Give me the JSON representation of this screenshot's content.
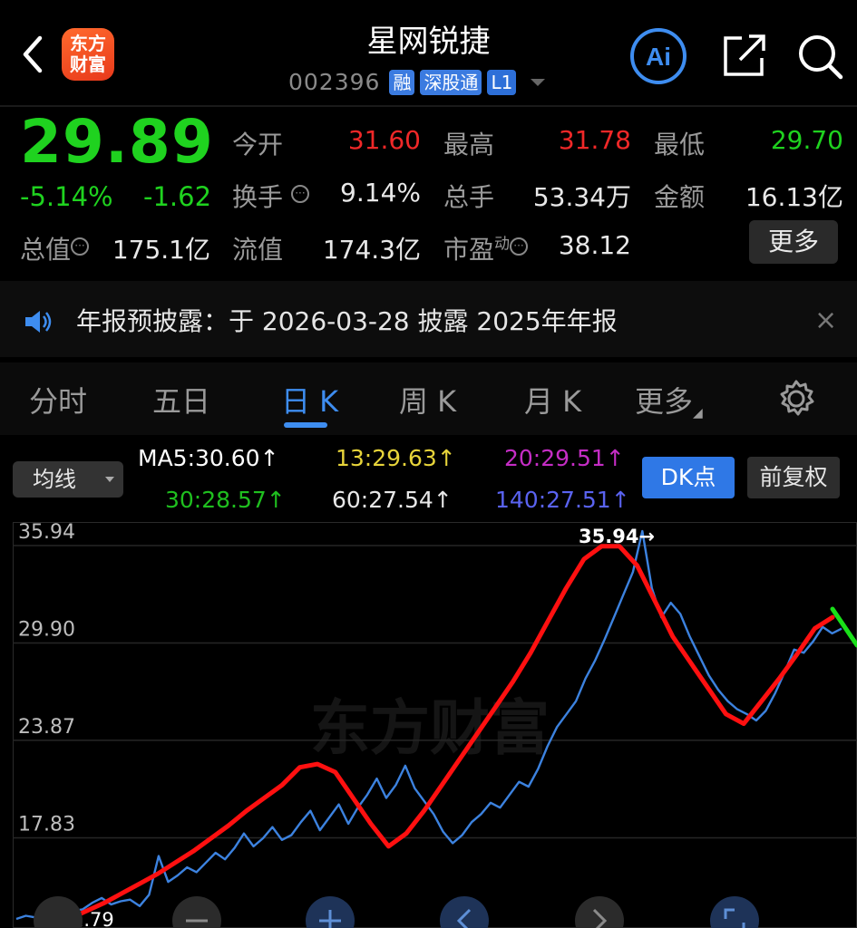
{
  "header": {
    "title": "星网锐捷",
    "code": "002396",
    "logo_text": [
      "东方",
      "财富"
    ],
    "tags": [
      "融",
      "深股通",
      "L1"
    ],
    "ai_label": "Ai"
  },
  "quote": {
    "price": "29.89",
    "change_pct": "-5.14%",
    "change_amt": "-1.62",
    "rows": [
      [
        {
          "label": "今开",
          "value": "31.60",
          "color": "red"
        },
        {
          "label": "最高",
          "value": "31.78",
          "color": "red"
        },
        {
          "label": "最低",
          "value": "29.70",
          "color": "green"
        }
      ],
      [
        {
          "label": "换手",
          "value": "9.14%"
        },
        {
          "label": "总手",
          "value": "53.34万"
        },
        {
          "label": "金额",
          "value": "16.13亿"
        }
      ]
    ],
    "total_cap_label": "总值",
    "total_cap": "175.1亿",
    "float_cap_label": "流值",
    "float_cap": "174.3亿",
    "pe_label": "市盈",
    "pe_sup": "动",
    "pe": "38.12",
    "more_label": "更多"
  },
  "notice": {
    "text": "年报预披露：于 2026-03-28 披露 2025年年报",
    "close": "×"
  },
  "tabs": [
    "分时",
    "五日",
    "日 K",
    "周 K",
    "月 K",
    "更多"
  ],
  "active_tab": "日 K",
  "ma": {
    "selector": "均线",
    "items": [
      {
        "text": "MA5:30.60↑",
        "color": "#e8e8e8"
      },
      {
        "text": "13:29.63↑",
        "color": "#e7d43a"
      },
      {
        "text": "20:29.51↑",
        "color": "#c52dc5"
      },
      {
        "text": "30:28.57↑",
        "color": "#1fbf1f"
      },
      {
        "text": "60:27.54↑",
        "color": "#e8e8e8"
      },
      {
        "text": "140:27.51↑",
        "color": "#5a63f0"
      }
    ],
    "dk_label": "DK点",
    "adj_label": "前复权"
  },
  "chart_data": {
    "type": "line",
    "y_ticks": [
      "35.94",
      "29.90",
      "23.87",
      "17.83"
    ],
    "ylim": [
      11.79,
      35.94
    ],
    "high_label": "35.94→",
    "low_label": "←11.79",
    "watermark": "东方财富",
    "series": [
      {
        "values": [
          11.9,
          12.1,
          12.0,
          12.3,
          12.2,
          12.6,
          12.4,
          12.5,
          12.9,
          13.2,
          12.8,
          13.0,
          13.1,
          12.7,
          13.4,
          15.8,
          14.2,
          14.6,
          15.1,
          14.8,
          15.4,
          16.0,
          15.6,
          16.3,
          17.2,
          16.4,
          16.9,
          17.6,
          16.8,
          17.1,
          17.9,
          18.6,
          17.4,
          18.2,
          19.0,
          17.8,
          18.8,
          19.6,
          20.6,
          19.4,
          20.2,
          21.4,
          20.0,
          19.2,
          18.4,
          17.3,
          16.6,
          17.1,
          17.9,
          18.4,
          19.1,
          18.8,
          19.6,
          20.4,
          20.1,
          21.2,
          22.6,
          23.8,
          24.6,
          25.4,
          26.8,
          27.9,
          29.2,
          30.6,
          32.0,
          33.4,
          35.94,
          32.4,
          30.6,
          31.5,
          30.8,
          29.4,
          28.2,
          27.0,
          26.1,
          25.4,
          24.9,
          24.6,
          24.2,
          24.8,
          25.9,
          27.2,
          28.6,
          28.4,
          29.1,
          30.0,
          29.6,
          29.89
        ]
      },
      {
        "name": "DK",
        "values": [
          11.9,
          12.4,
          12.9,
          13.5,
          14.1,
          14.7,
          15.4,
          16.1,
          16.9,
          17.7,
          18.6,
          19.4,
          20.2,
          21.3,
          21.5,
          21.0,
          19.4,
          17.8,
          16.4,
          17.2,
          18.6,
          20.2,
          21.8,
          23.4,
          25.0,
          26.6,
          28.4,
          30.4,
          32.4,
          34.2,
          35.0,
          35.0,
          33.8,
          31.6,
          29.4,
          27.8,
          26.2,
          24.6,
          24.0,
          25.4,
          26.8,
          28.3,
          29.9,
          30.6
        ]
      }
    ]
  }
}
